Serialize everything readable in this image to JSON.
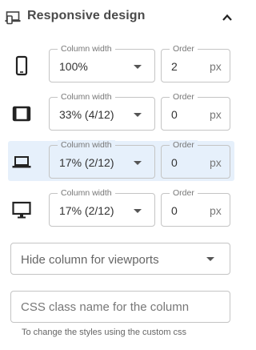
{
  "header": {
    "title": "Responsive design",
    "icon": "responsive-devices-icon",
    "collapse_icon": "chevron-up-icon"
  },
  "rows": [
    {
      "device": "mobile",
      "icon": "mobile-icon",
      "column_width_label": "Column width",
      "column_width_value": "100%",
      "order_label": "Order",
      "order_value": "2",
      "order_unit": "px",
      "active": false
    },
    {
      "device": "tablet",
      "icon": "tablet-icon",
      "column_width_label": "Column width",
      "column_width_value": "33% (4/12)",
      "order_label": "Order",
      "order_value": "0",
      "order_unit": "px",
      "active": false
    },
    {
      "device": "laptop",
      "icon": "laptop-icon",
      "column_width_label": "Column width",
      "column_width_value": "17% (2/12)",
      "order_label": "Order",
      "order_value": "0",
      "order_unit": "px",
      "active": true
    },
    {
      "device": "desktop",
      "icon": "desktop-icon",
      "column_width_label": "Column width",
      "column_width_value": "17% (2/12)",
      "order_label": "Order",
      "order_value": "0",
      "order_unit": "px",
      "active": false
    }
  ],
  "hide_viewports": {
    "placeholder": "Hide column for viewports"
  },
  "css_class": {
    "placeholder": "CSS class name for the column",
    "value": ""
  },
  "helper_text": "To change the styles using the custom css",
  "colors": {
    "active_row_bg": "#e6f0fb",
    "border": "#c4c4c4",
    "icon": "#222222"
  }
}
